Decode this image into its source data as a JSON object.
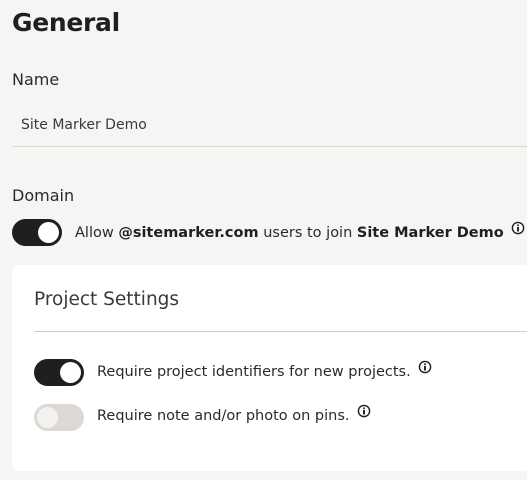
{
  "page": {
    "title": "General"
  },
  "name_section": {
    "label": "Name",
    "value": "Site Marker Demo"
  },
  "domain_section": {
    "label": "Domain",
    "toggle_state": "on",
    "text_prefix": "Allow ",
    "domain": "@sitemarker.com",
    "text_middle": " users to join ",
    "project_name": "Site Marker Demo"
  },
  "project_settings": {
    "title": "Project Settings",
    "settings": [
      {
        "label": "Require project identifiers for new projects.",
        "state": "on"
      },
      {
        "label": "Require note and/or photo on pins.",
        "state": "off"
      }
    ]
  },
  "colors": {
    "background": "#f6f5f3",
    "toggle_on": "#1f1f1f",
    "toggle_off": "#dcd9d5",
    "card": "#ffffff"
  },
  "icons": {
    "info": "info-circle-icon"
  }
}
